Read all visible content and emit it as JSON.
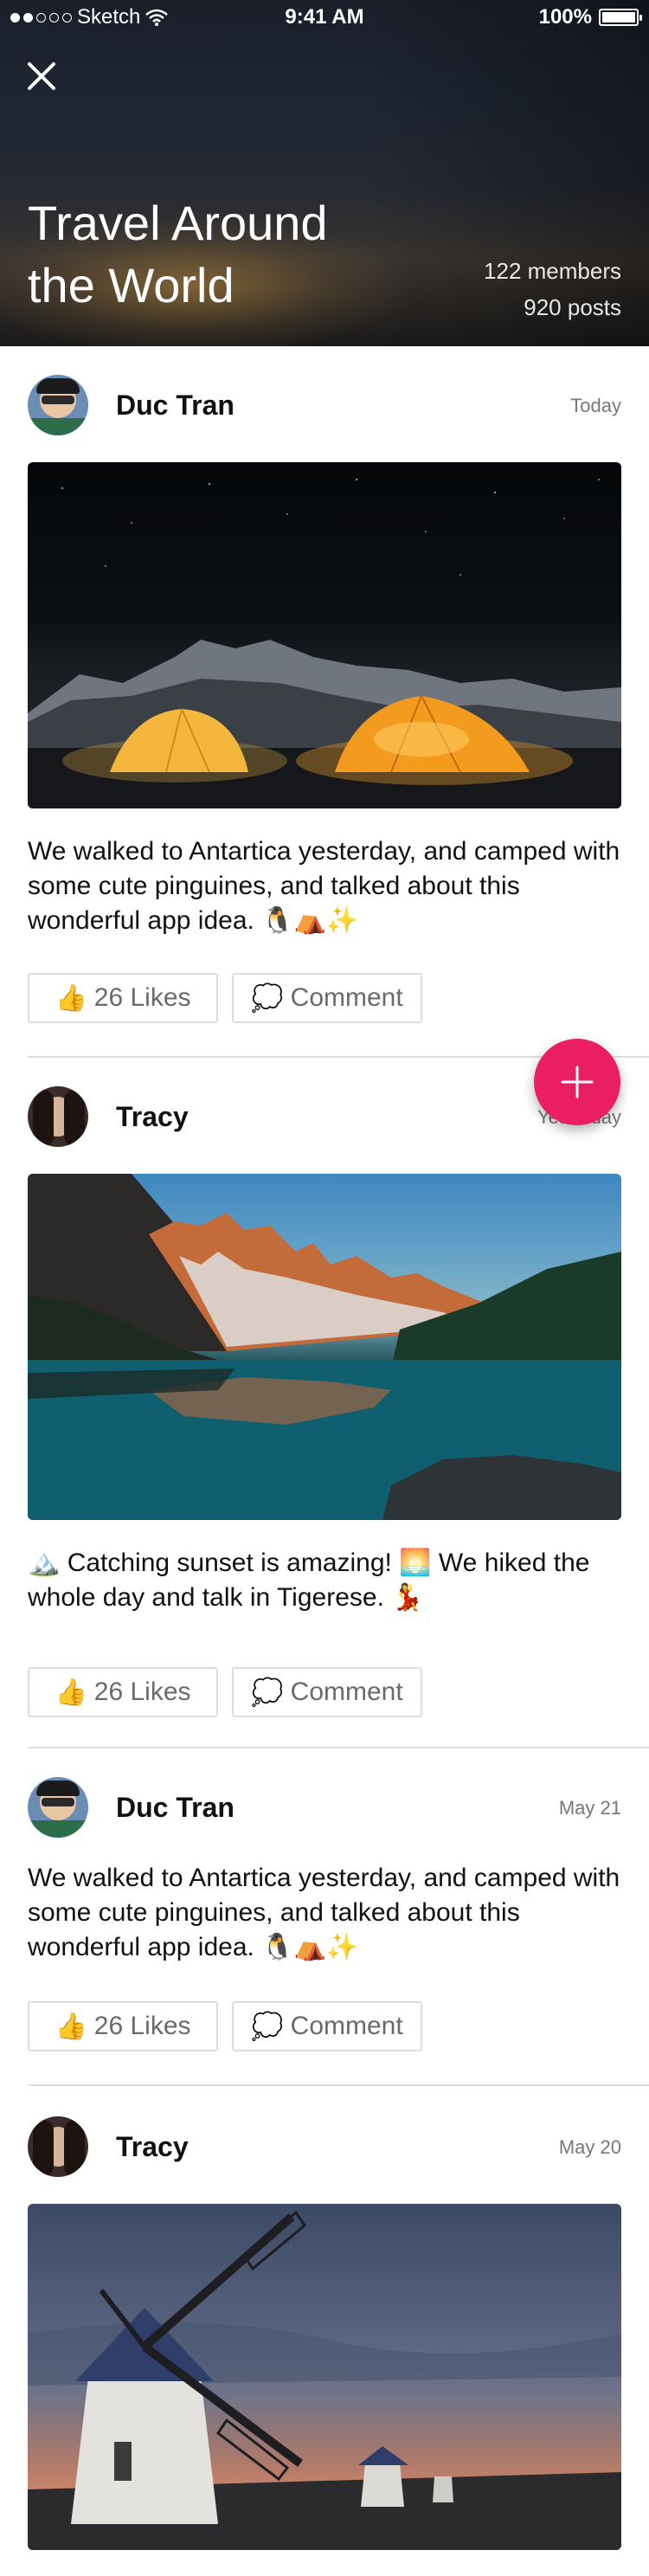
{
  "status_bar": {
    "carrier": "Sketch",
    "time": "9:41 AM",
    "battery": "100%"
  },
  "group": {
    "title": "Travel Around the World",
    "members": "122 members",
    "posts": "920 posts"
  },
  "posts": [
    {
      "author": "Duc Tran",
      "date": "Today",
      "text": "We walked to Antartica yesterday, and camped with some cute pinguines, and talked about this wonderful app idea. 🐧⛺✨",
      "likes": "26 Likes",
      "comment": "Comment"
    },
    {
      "author": "Tracy",
      "date": "Yesterday",
      "text": "🏔️ Catching sunset is amazing! 🌅 We hiked the whole day and talk in Tigerese. 💃",
      "likes": "26 Likes",
      "comment": "Comment"
    },
    {
      "author": "Duc Tran",
      "date": "May 21",
      "text": "We walked to Antartica yesterday, and camped with some cute pinguines, and talked about this wonderful app idea. 🐧⛺✨",
      "likes": "26 Likes",
      "comment": "Comment"
    },
    {
      "author": "Tracy",
      "date": "May 20"
    }
  ],
  "icons": {
    "close": "close-icon",
    "wifi": "wifi-icon",
    "like": "thumbs-up-icon",
    "comment": "speech-bubble-icon",
    "add": "plus-icon"
  },
  "colors": {
    "fab": "#e91e63",
    "border": "#dddddd"
  }
}
